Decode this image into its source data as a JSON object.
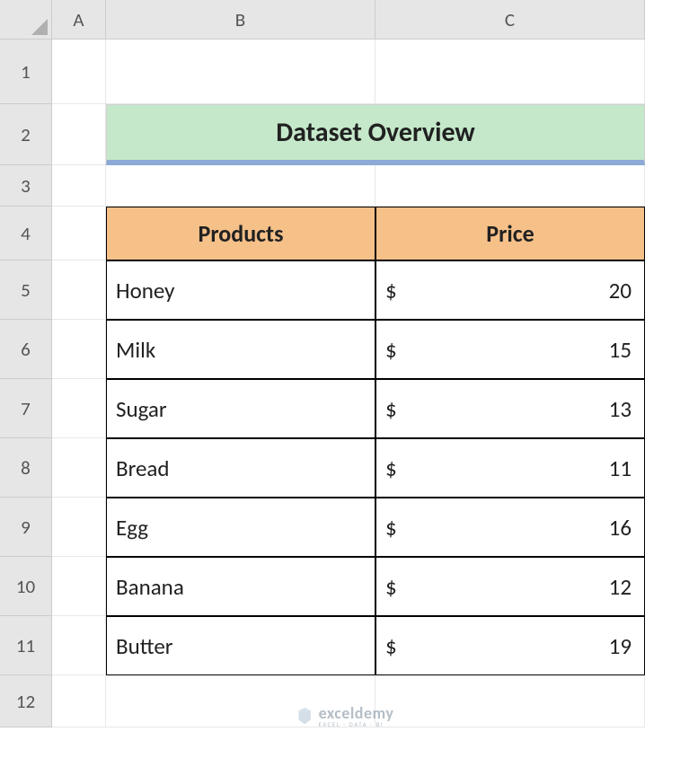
{
  "columns": [
    "A",
    "B",
    "C"
  ],
  "rows": [
    "1",
    "2",
    "3",
    "4",
    "5",
    "6",
    "7",
    "8",
    "9",
    "10",
    "11",
    "12"
  ],
  "title": "Dataset Overview",
  "headers": {
    "products": "Products",
    "price": "Price"
  },
  "currency": "$",
  "data": [
    {
      "product": "Honey",
      "price": "20"
    },
    {
      "product": "Milk",
      "price": "15"
    },
    {
      "product": "Sugar",
      "price": "13"
    },
    {
      "product": "Bread",
      "price": "11"
    },
    {
      "product": "Egg",
      "price": "16"
    },
    {
      "product": "Banana",
      "price": "12"
    },
    {
      "product": "Butter",
      "price": "19"
    }
  ],
  "watermark": {
    "main": "exceldemy",
    "sub": "EXCEL · DATA · BI"
  }
}
